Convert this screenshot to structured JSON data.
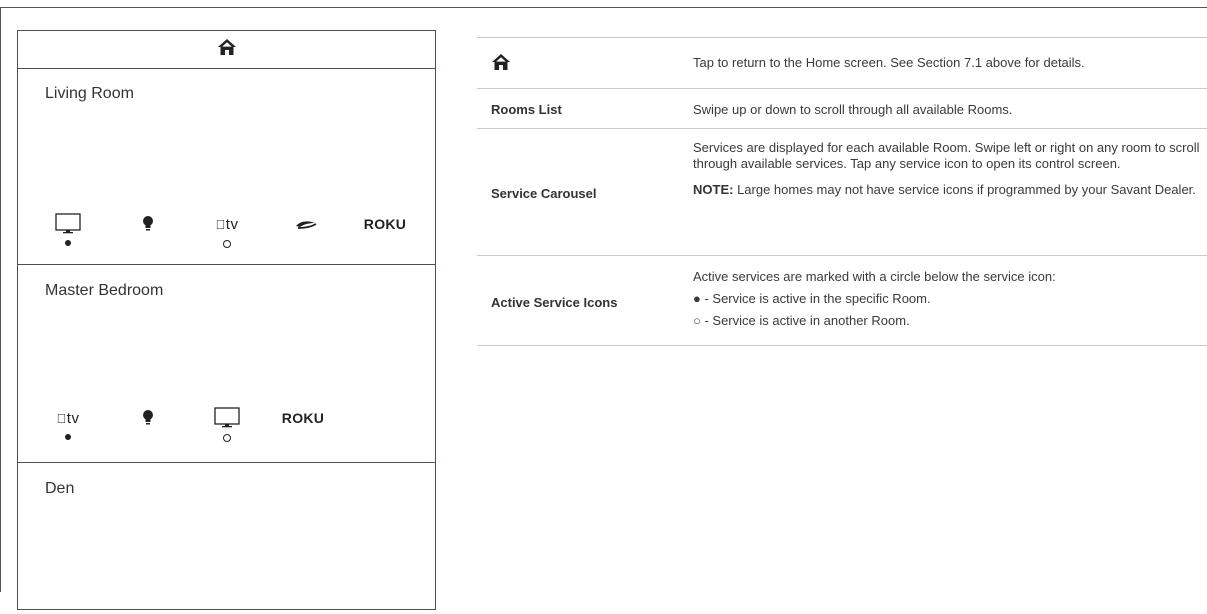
{
  "phone": {
    "header_icon": "home-icon",
    "rooms": [
      {
        "name": "Living Room",
        "services": [
          {
            "icon": "tv-monitor-icon",
            "status": "active-here"
          },
          {
            "icon": "lightbulb-icon",
            "status": "none"
          },
          {
            "icon": "apple-tv-icon",
            "label": "tv",
            "status": "active-elsewhere"
          },
          {
            "icon": "bluray-icon",
            "status": "none"
          },
          {
            "icon": "roku-icon",
            "label": "ROKU",
            "status": "none"
          }
        ]
      },
      {
        "name": "Master Bedroom",
        "services": [
          {
            "icon": "apple-tv-icon",
            "label": "tv",
            "status": "active-here"
          },
          {
            "icon": "lightbulb-icon",
            "status": "none"
          },
          {
            "icon": "tv-monitor-icon",
            "status": "active-elsewhere"
          },
          {
            "icon": "roku-icon",
            "label": "ROKU",
            "status": "none"
          }
        ]
      },
      {
        "name": "Den",
        "services": []
      }
    ]
  },
  "table": {
    "rows": [
      {
        "term_icon": "home-icon",
        "desc": [
          "Tap to return to the Home screen.  See Section 7.1 above for details."
        ]
      },
      {
        "term": "Rooms List",
        "desc": [
          "Swipe up or down to scroll through all available Rooms."
        ]
      },
      {
        "term": "Service Carousel",
        "desc": [
          "Services are displayed for each available Room. Swipe left or right on any room to scroll through available services.  Tap any service icon to open its control screen."
        ],
        "note_label": "NOTE:",
        "note_text": " Large homes may not have service icons if programmed by your Savant Dealer."
      },
      {
        "term": "Active Service Icons",
        "desc": [
          "Active services are marked with a circle below the service icon:",
          "● - Service is active in the specific Room.",
          "○ - Service is active in another Room."
        ]
      }
    ]
  }
}
